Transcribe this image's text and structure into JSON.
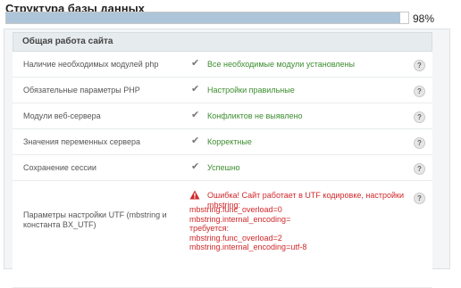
{
  "page_title": "Структура базы данных",
  "progress": {
    "percent_label": "98%",
    "value": 0.98
  },
  "panel": {
    "header": "Общая работа сайта"
  },
  "checks": [
    {
      "label": "Наличие необходимых модулей php",
      "status": "Все необходимые модули установлены"
    },
    {
      "label": "Обязательные параметры PHP",
      "status": "Настройки правильные"
    },
    {
      "label": "Модули веб-сервера",
      "status": "Конфликтов не выявлено"
    },
    {
      "label": "Значения переменных сервера",
      "status": "Корректные"
    },
    {
      "label": "Сохранение сессии",
      "status": "Успешно"
    }
  ],
  "utf_check": {
    "label": "Параметры настройки UTF (mbstring и константа BX_UTF)",
    "error_head": "Ошибка! Сайт работает в UTF кодировке, настройки mbstring:",
    "lines": [
      "mbstring.func_overload=0",
      "mbstring.internal_encoding=",
      "требуется:",
      "mbstring.func_overload=2",
      "mbstring.internal_encoding=utf-8"
    ]
  },
  "help_glyph": "?",
  "check_glyph": "✔",
  "colors": {
    "ok": "#3c8d2f",
    "error": "#d0282a",
    "progress": "#aec4d9"
  },
  "icons": {
    "check": "check-icon",
    "warning": "warning-icon",
    "help": "help-icon"
  }
}
